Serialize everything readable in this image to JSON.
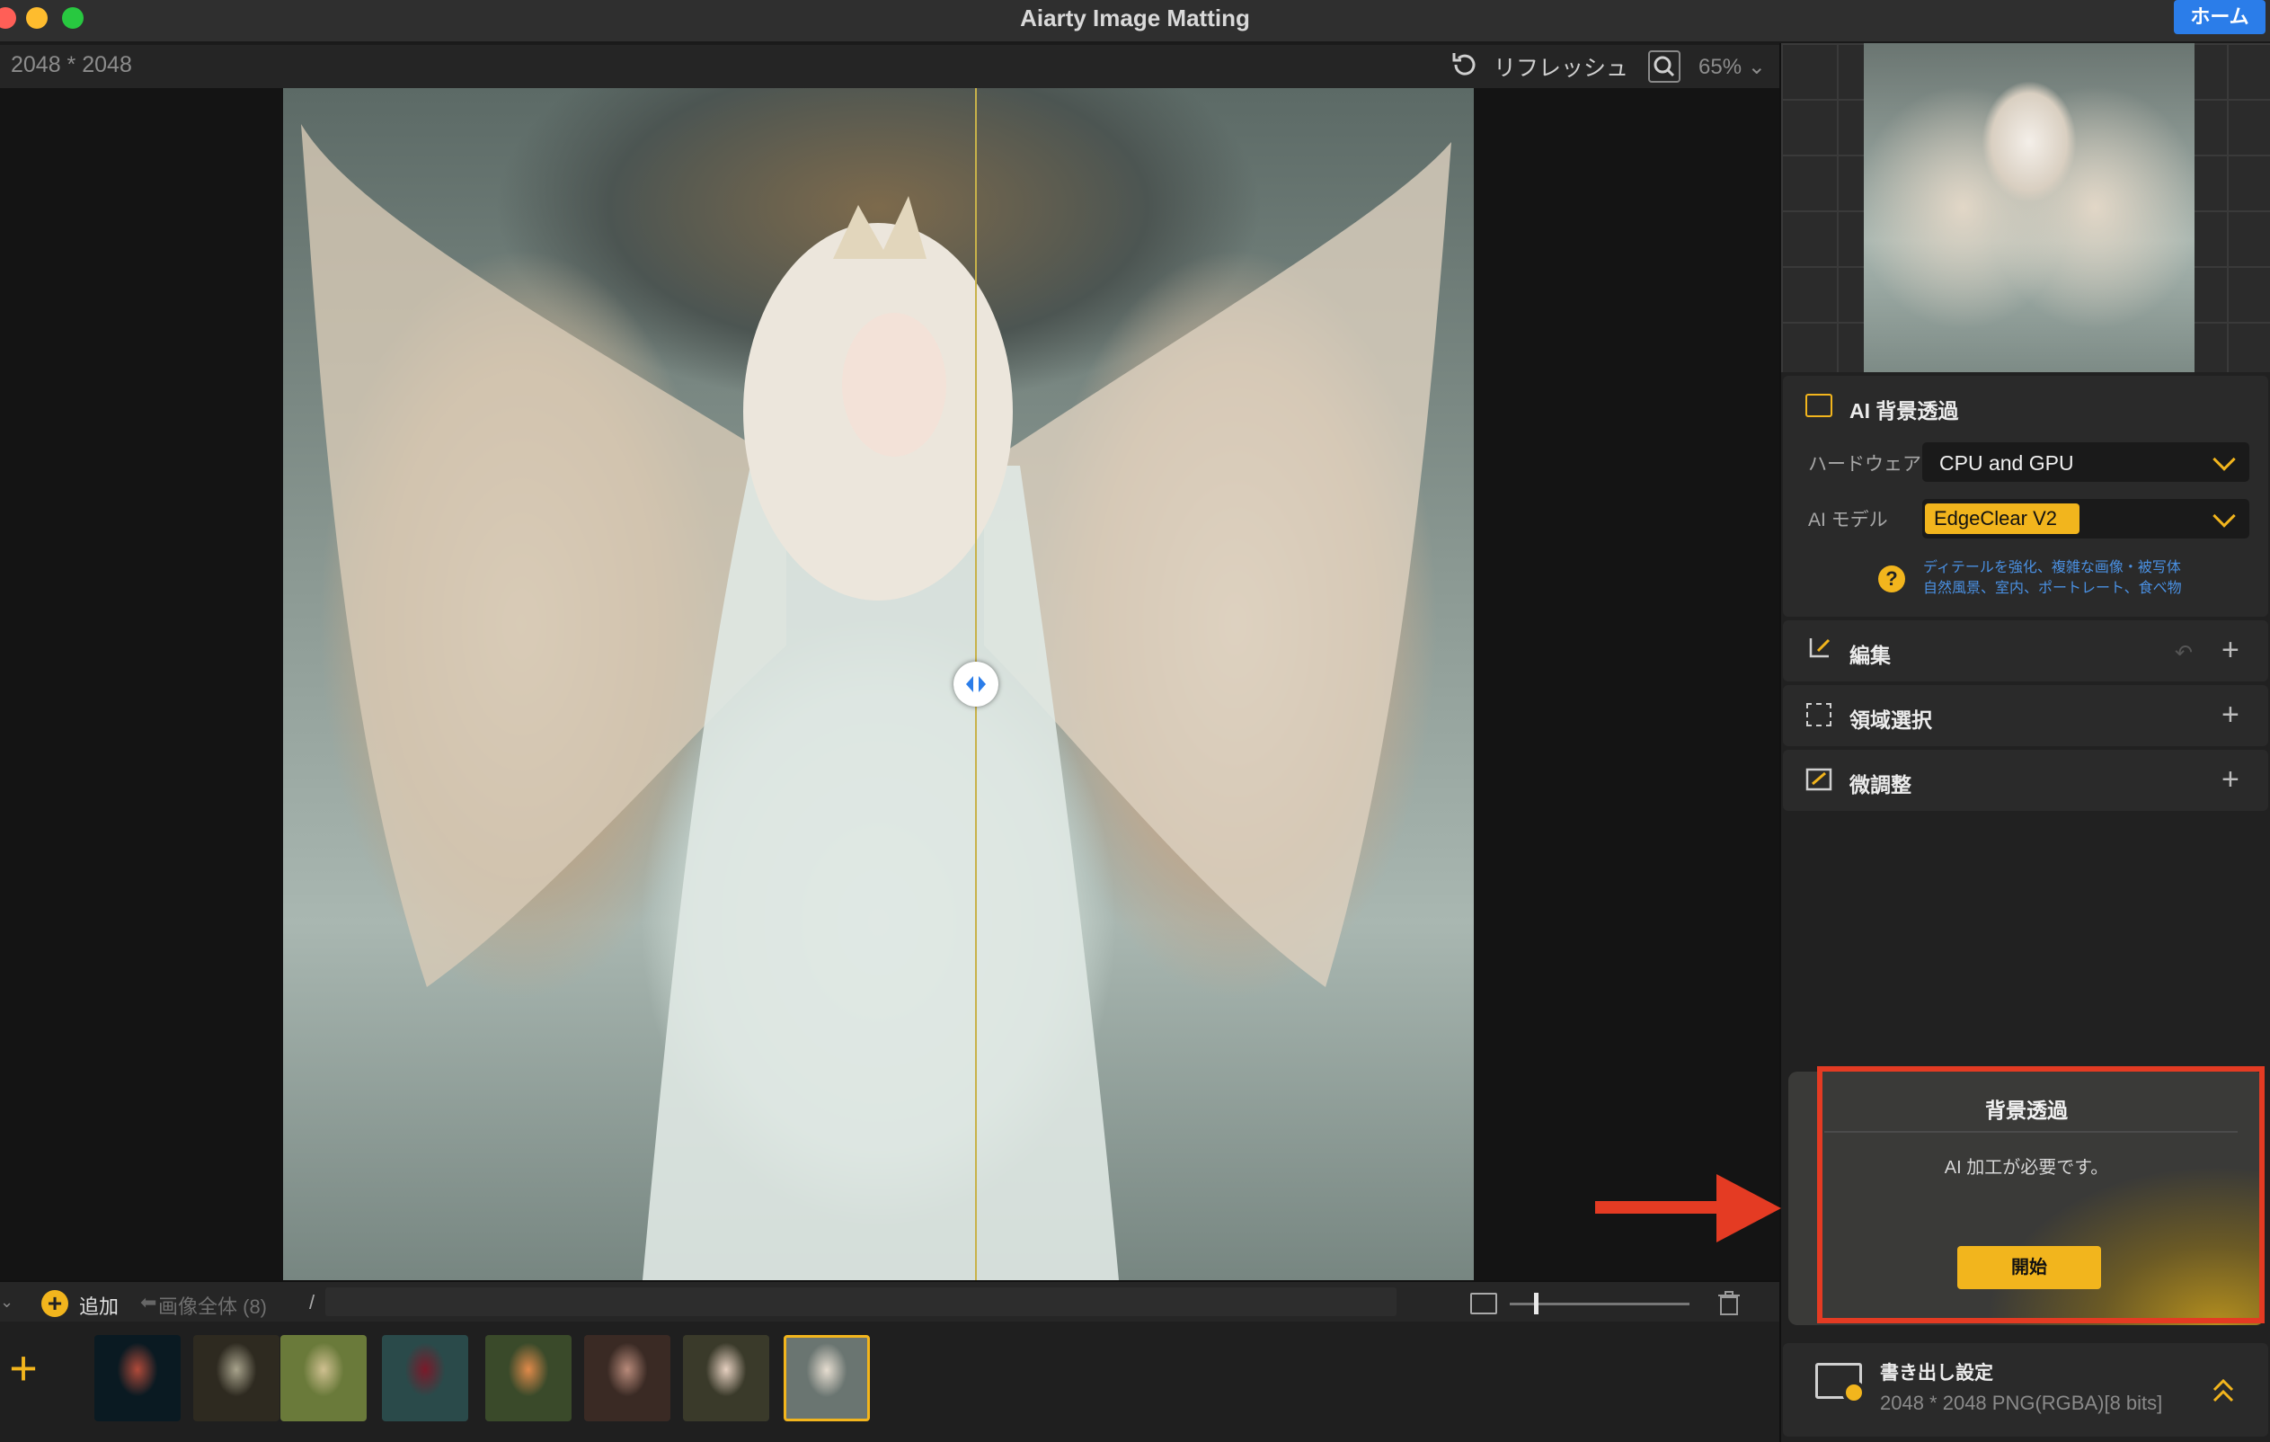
{
  "window": {
    "title": "Aiarty Image Matting",
    "home_label": "ホーム"
  },
  "toolbar": {
    "dimensions": "2048 * 2048",
    "refresh_label": "リフレッシュ",
    "zoom": "65%"
  },
  "strip": {
    "add_label": "追加",
    "all_images": "画像全体 (8)",
    "breadcrumb_sep": "/"
  },
  "thumbnails": [
    {
      "name": "jellyfish",
      "colors": [
        "#0a1a22",
        "#b04a3a"
      ]
    },
    {
      "name": "mossy-branches",
      "colors": [
        "#2e2a20",
        "#a8a38c"
      ]
    },
    {
      "name": "bicycle",
      "colors": [
        "#6a7a3a",
        "#cfc090"
      ]
    },
    {
      "name": "woman-red-dress-forest",
      "colors": [
        "#2a4a4a",
        "#7a1a2a"
      ]
    },
    {
      "name": "woman-flower-bouquet",
      "colors": [
        "#3a4a2a",
        "#e08a4a"
      ]
    },
    {
      "name": "woman-lace-dress",
      "colors": [
        "#3a2a24",
        "#b88a7a"
      ]
    },
    {
      "name": "woman-roses",
      "colors": [
        "#3a3a2a",
        "#e6d0c0"
      ]
    },
    {
      "name": "angel",
      "colors": [
        "#6a7571",
        "#e6ddd0"
      ],
      "selected": true
    }
  ],
  "panel": {
    "ai_section": {
      "title": "AI 背景透過",
      "hardware_label": "ハードウェア",
      "hardware_value": "CPU and GPU",
      "model_label": "AI モデル",
      "model_value": "EdgeClear  V2",
      "help_line1": "ディテールを強化、複雑な画像・被写体",
      "help_line2": "自然風景、室内、ポートレート、食べ物"
    },
    "edit_title": "編集",
    "region_title": "領域選択",
    "fine_title": "微調整",
    "start_card": {
      "title": "背景透過",
      "message": "AI 加工が必要です。",
      "button": "開始"
    },
    "export": {
      "title": "書き出し設定",
      "info": "2048 * 2048 PNG(RGBA)[8 bits]"
    }
  },
  "colors": {
    "accent": "#f2b51d",
    "highlight": "#e43b23",
    "home": "#2b7de9"
  }
}
